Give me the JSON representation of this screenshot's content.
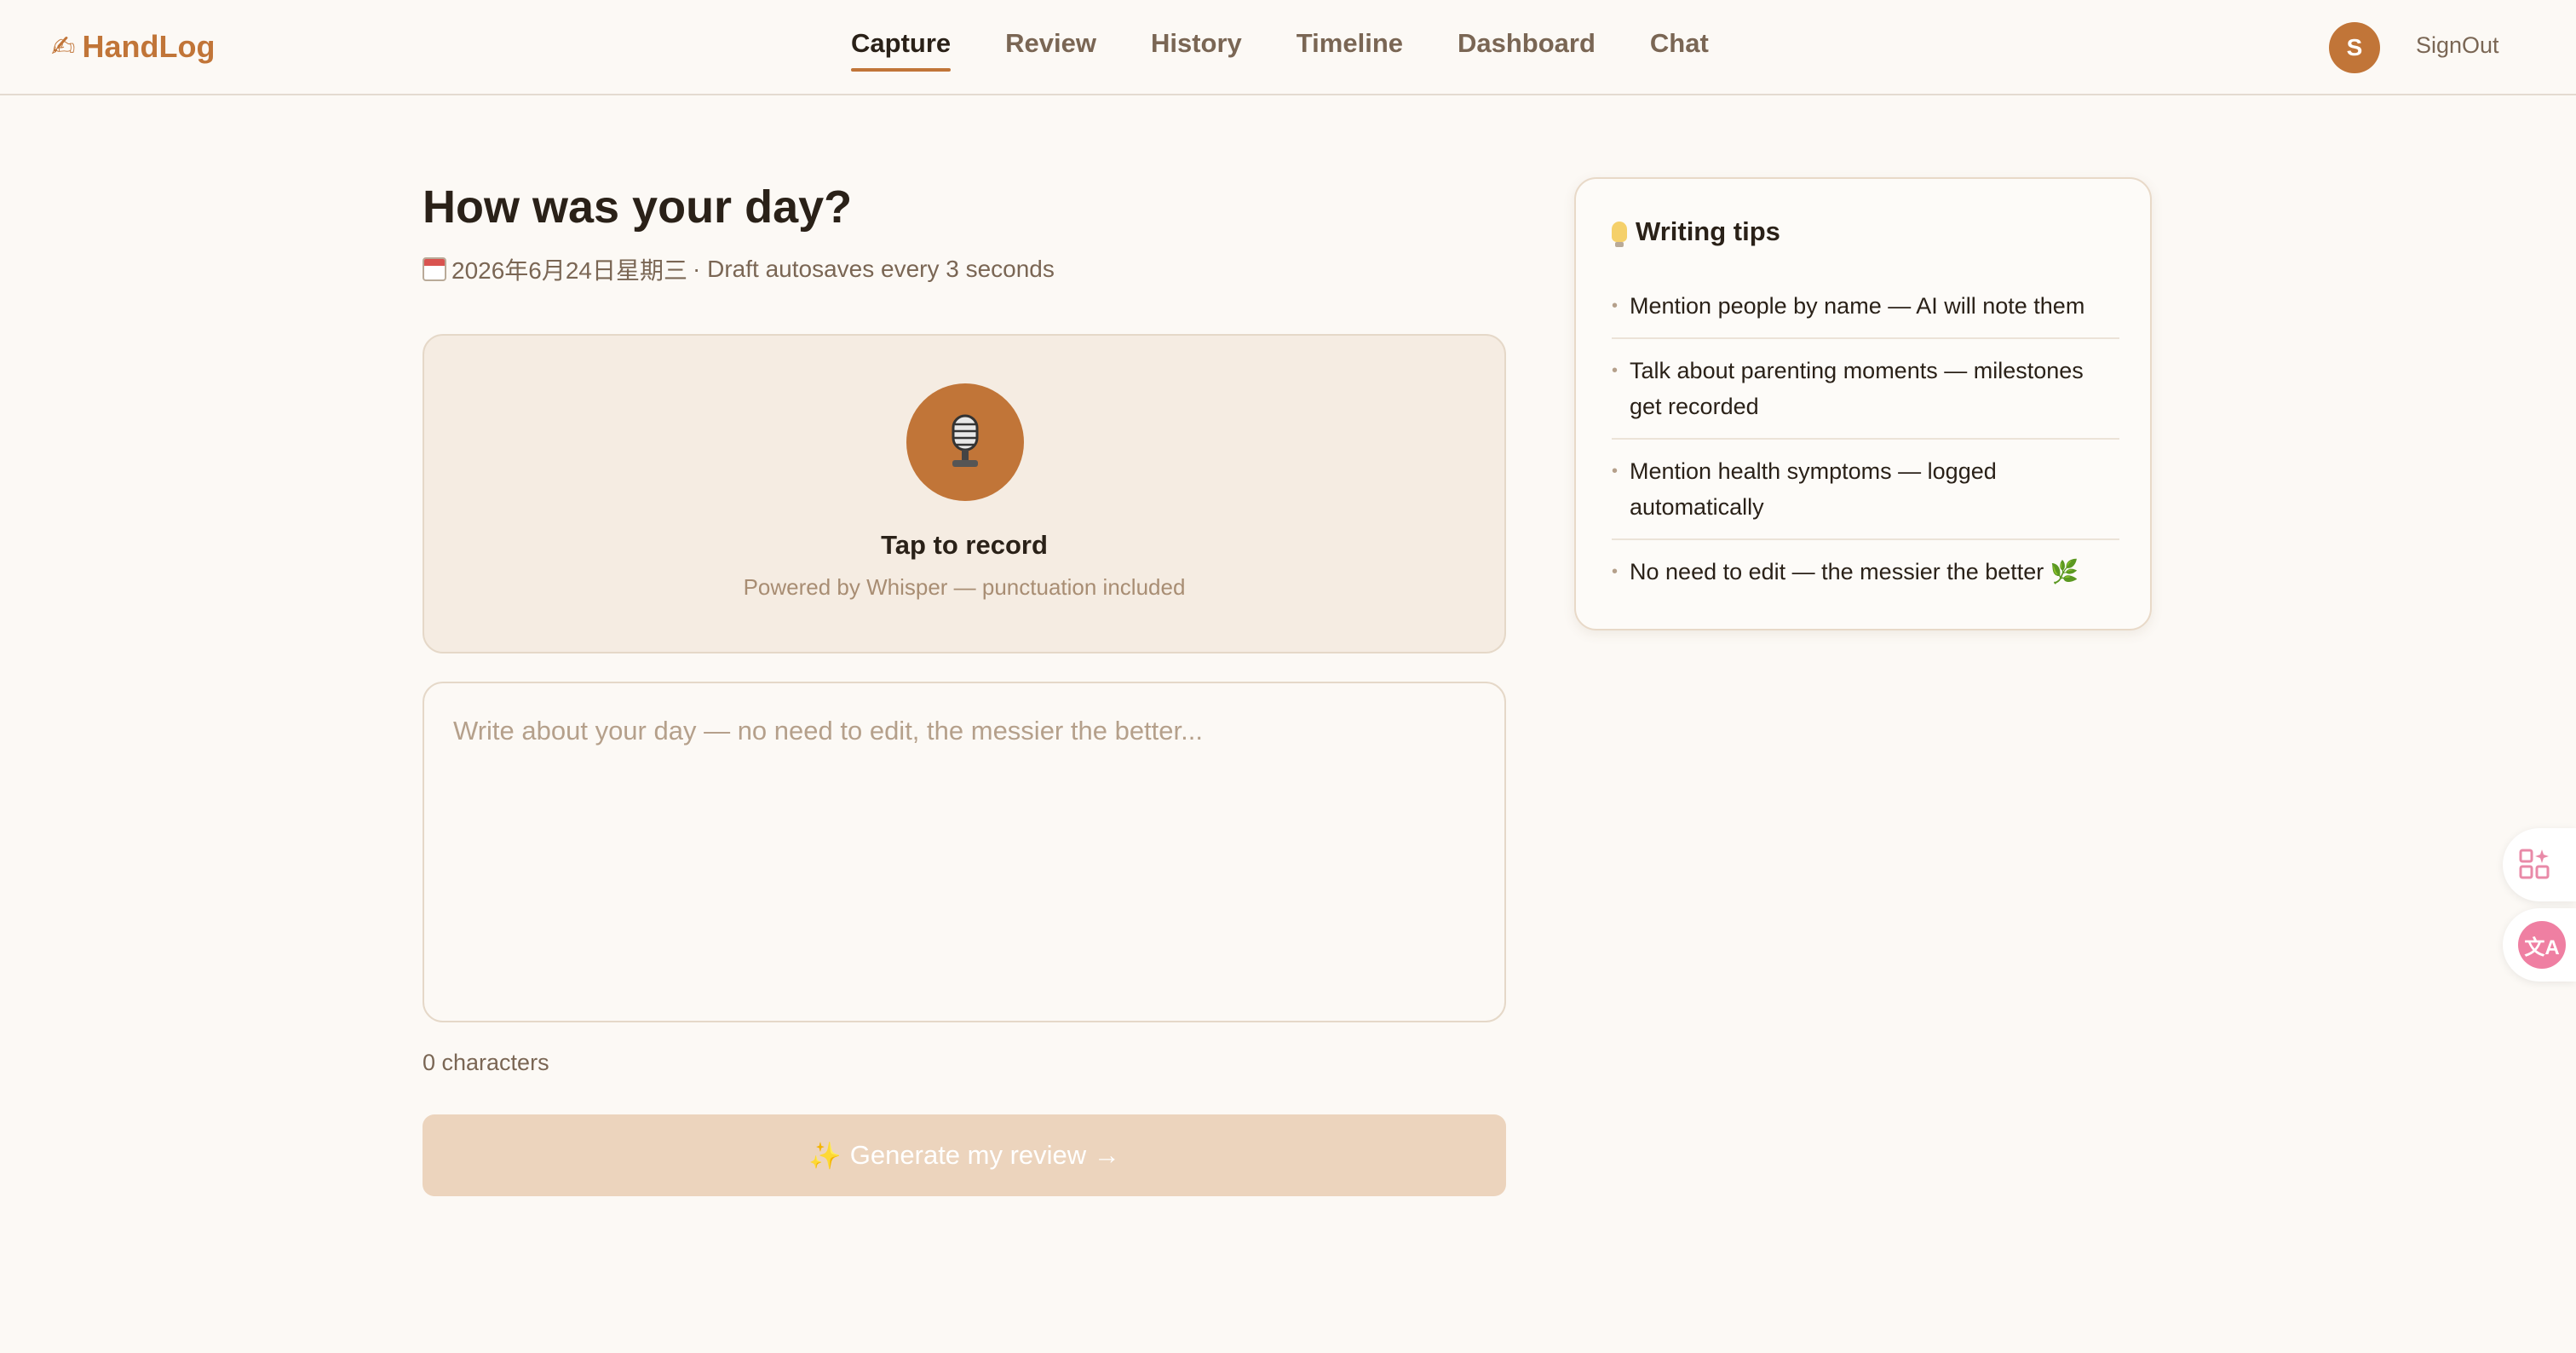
{
  "app": {
    "name": "HandLog",
    "logo_icon": "writing-hand-icon",
    "brand_color": "#c17538"
  },
  "nav": {
    "items": [
      {
        "label": "Capture",
        "active": true
      },
      {
        "label": "Review",
        "active": false
      },
      {
        "label": "History",
        "active": false
      },
      {
        "label": "Timeline",
        "active": false
      },
      {
        "label": "Dashboard",
        "active": false
      },
      {
        "label": "Chat",
        "active": false
      }
    ]
  },
  "user": {
    "avatar_initial": "S",
    "signout_label": "SignOut"
  },
  "main": {
    "title": "How was your day?",
    "date_text": "2026年6月24日星期三",
    "autosave_text": "· Draft autosaves every 3 seconds",
    "record": {
      "label": "Tap to record",
      "sublabel": "Powered by Whisper — punctuation included",
      "icon": "microphone-icon"
    },
    "editor": {
      "placeholder": "Write about your day — no need to edit, the messier the better...",
      "value": ""
    },
    "char_count": "0 characters",
    "generate_label": "Generate my review →"
  },
  "tips": {
    "title": "Writing tips",
    "items": [
      "Mention people by name — AI will note them",
      "Talk about parenting moments — milestones get recorded",
      "Mention health symptoms — logged automatically",
      "No need to edit — the messier the better 🌿"
    ]
  },
  "side_widgets": {
    "icons": [
      "apps-sparkle-icon",
      "translate-icon"
    ],
    "translate_glyph": "文A"
  }
}
